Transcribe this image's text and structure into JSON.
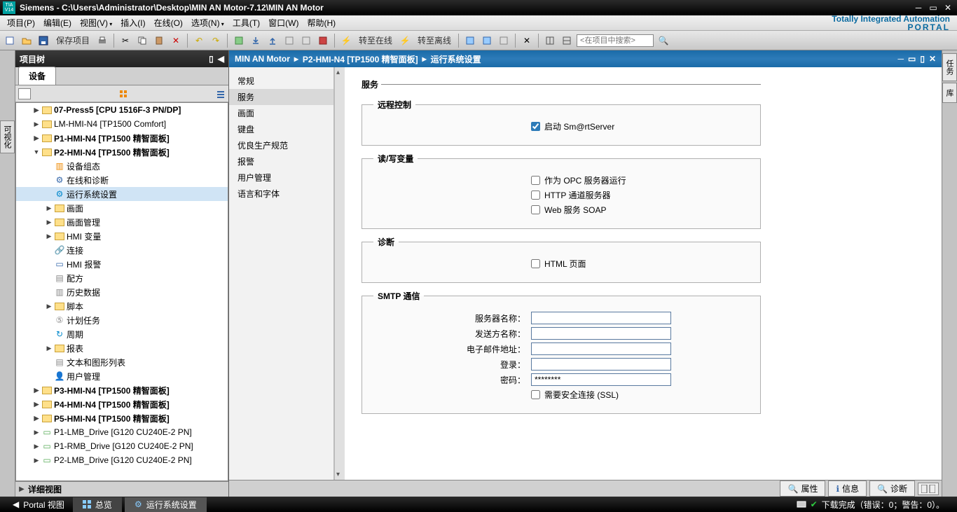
{
  "window": {
    "title": "Siemens  -  C:\\Users\\Administrator\\Desktop\\MIN AN Motor-7.12\\MIN AN Motor",
    "logo_top": "TIA",
    "logo_bot": "V14"
  },
  "menu": {
    "items": [
      "项目(P)",
      "编辑(E)",
      "视图(V)",
      "插入(I)",
      "在线(O)",
      "选项(N)",
      "工具(T)",
      "窗口(W)",
      "帮助(H)"
    ],
    "brand1": "Totally Integrated Automation",
    "brand2": "PORTAL"
  },
  "toolbar": {
    "save_label": "保存项目",
    "go_online": "转至在线",
    "go_offline": "转至离线",
    "search_placeholder": "<在项目中搜索>"
  },
  "left_tabs": [
    "可视化"
  ],
  "right_tabs": [
    "任务",
    "库"
  ],
  "project_panel": {
    "title": "项目树",
    "subtab": "设备",
    "footer": "详细视图"
  },
  "tree": {
    "rows": [
      {
        "d": 1,
        "exp": "▶",
        "icon": "folder",
        "label": "07-Press5 [CPU 1516F-3 PN/DP]",
        "bold": true
      },
      {
        "d": 1,
        "exp": "▶",
        "icon": "folder",
        "label": "LM-HMI-N4 [TP1500 Comfort]",
        "bold": false
      },
      {
        "d": 1,
        "exp": "▶",
        "icon": "folder",
        "label": "P1-HMI-N4 [TP1500 精智面板]",
        "bold": true
      },
      {
        "d": 1,
        "exp": "▼",
        "icon": "folder",
        "label": "P2-HMI-N4 [TP1500 精智面板]",
        "bold": true
      },
      {
        "d": 2,
        "exp": "",
        "icon": "dev",
        "label": "设备组态",
        "bold": false
      },
      {
        "d": 2,
        "exp": "",
        "icon": "diag",
        "label": "在线和诊断",
        "bold": false
      },
      {
        "d": 2,
        "exp": "",
        "icon": "rt",
        "label": "运行系统设置",
        "bold": false,
        "selected": true
      },
      {
        "d": 2,
        "exp": "▶",
        "icon": "folder",
        "label": "画面",
        "bold": false
      },
      {
        "d": 2,
        "exp": "▶",
        "icon": "folder",
        "label": "画面管理",
        "bold": false
      },
      {
        "d": 2,
        "exp": "▶",
        "icon": "folder",
        "label": "HMI 变量",
        "bold": false
      },
      {
        "d": 2,
        "exp": "",
        "icon": "conn",
        "label": "连接",
        "bold": false
      },
      {
        "d": 2,
        "exp": "",
        "icon": "alarm",
        "label": "HMI 报警",
        "bold": false
      },
      {
        "d": 2,
        "exp": "",
        "icon": "recipe",
        "label": "配方",
        "bold": false
      },
      {
        "d": 2,
        "exp": "",
        "icon": "hist",
        "label": "历史数据",
        "bold": false
      },
      {
        "d": 2,
        "exp": "▶",
        "icon": "folder",
        "label": "脚本",
        "bold": false
      },
      {
        "d": 2,
        "exp": "",
        "icon": "sched",
        "label": "计划任务",
        "bold": false
      },
      {
        "d": 2,
        "exp": "",
        "icon": "cycle",
        "label": "周期",
        "bold": false
      },
      {
        "d": 2,
        "exp": "▶",
        "icon": "folder",
        "label": "报表",
        "bold": false
      },
      {
        "d": 2,
        "exp": "",
        "icon": "text",
        "label": "文本和图形列表",
        "bold": false
      },
      {
        "d": 2,
        "exp": "",
        "icon": "user",
        "label": "用户管理",
        "bold": false
      },
      {
        "d": 1,
        "exp": "▶",
        "icon": "folder",
        "label": "P3-HMI-N4 [TP1500 精智面板]",
        "bold": true
      },
      {
        "d": 1,
        "exp": "▶",
        "icon": "folder",
        "label": "P4-HMI-N4 [TP1500 精智面板]",
        "bold": true
      },
      {
        "d": 1,
        "exp": "▶",
        "icon": "folder",
        "label": "P5-HMI-N4 [TP1500 精智面板]",
        "bold": true
      },
      {
        "d": 1,
        "exp": "▶",
        "icon": "drive",
        "label": "P1-LMB_Drive [G120 CU240E-2 PN]",
        "bold": false
      },
      {
        "d": 1,
        "exp": "▶",
        "icon": "drive",
        "label": "P1-RMB_Drive [G120 CU240E-2 PN]",
        "bold": false
      },
      {
        "d": 1,
        "exp": "▶",
        "icon": "drive",
        "label": "P2-LMB_Drive [G120 CU240E-2 PN]",
        "bold": false
      }
    ]
  },
  "editor": {
    "crumb1": "MIN AN Motor",
    "crumb2": "P2-HMI-N4 [TP1500 精智面板]",
    "crumb3": "运行系统设置",
    "nav": [
      "常规",
      "服务",
      "画面",
      "键盘",
      "优良生产规范",
      "报警",
      "用户管理",
      "语言和字体"
    ],
    "nav_active": 1,
    "section_title": "服务",
    "fs_remote": {
      "legend": "远程控制",
      "cb1_label": "启动 Sm@rtServer",
      "cb1_checked": true
    },
    "fs_rw": {
      "legend": "读/写变量",
      "cb1": "作为 OPC 服务器运行",
      "cb2": "HTTP 通道服务器",
      "cb3": "Web 服务 SOAP"
    },
    "fs_diag": {
      "legend": "诊断",
      "cb1": "HTML 页面"
    },
    "fs_smtp": {
      "legend": "SMTP 通信",
      "server": "服务器名称：",
      "sender": "发送方名称：",
      "email": "电子邮件地址：",
      "login": "登录：",
      "password": "密码：",
      "password_val": "********",
      "ssl": "需要安全连接 (SSL)"
    },
    "footer_tabs": [
      "属性",
      "信息",
      "诊断"
    ]
  },
  "statusbar": {
    "portal_view": "Portal 视图",
    "overview": "总览",
    "rt_settings": "运行系统设置",
    "dl_done": "下载完成（错误：0；警告：0）。"
  }
}
